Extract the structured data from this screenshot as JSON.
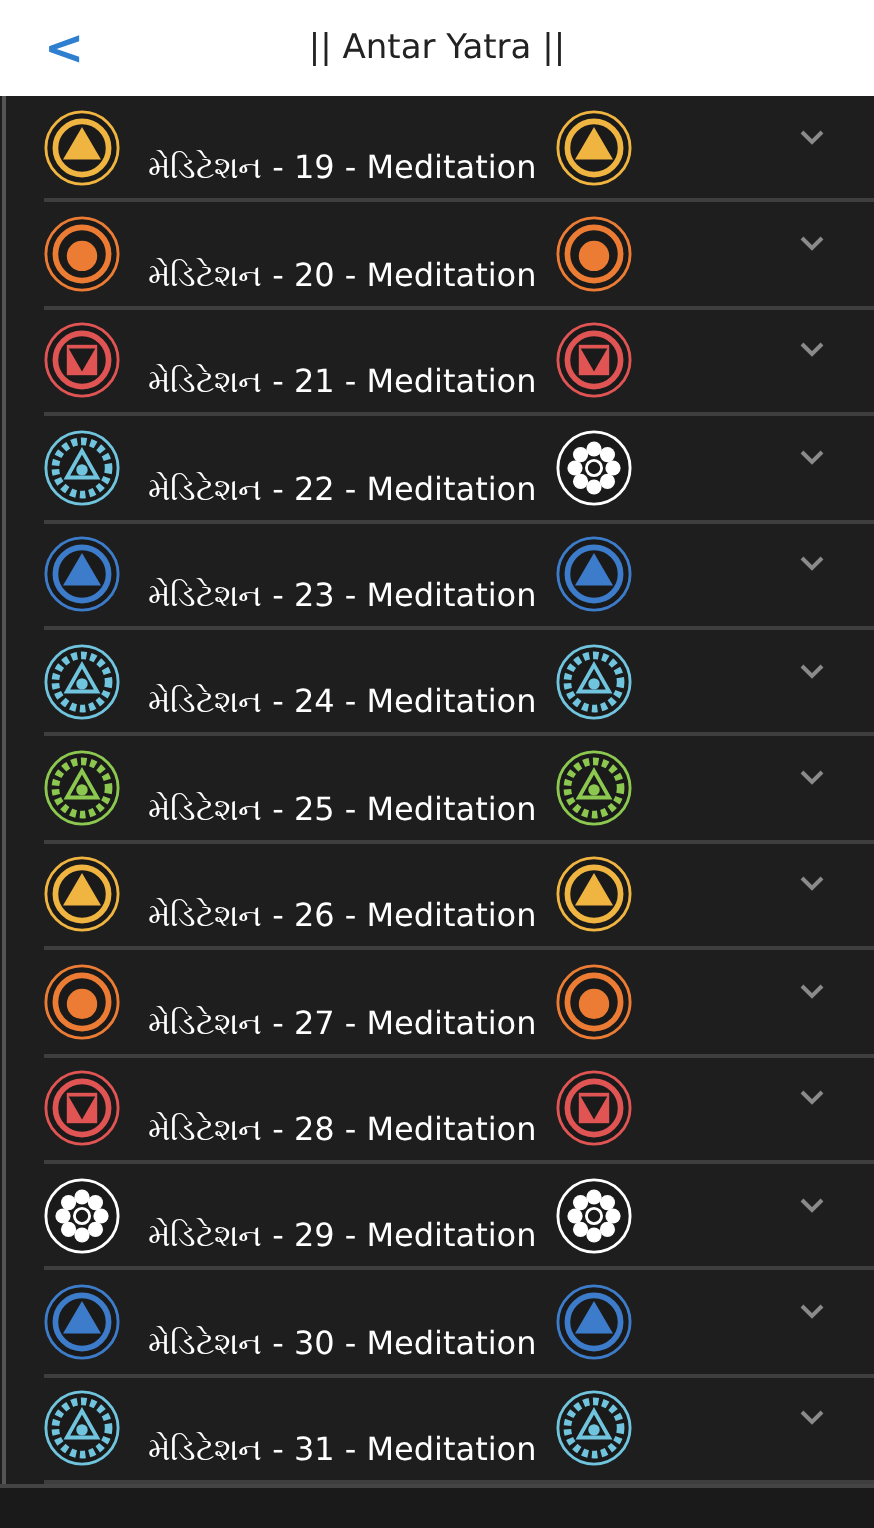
{
  "header": {
    "back": "<",
    "title": "|| Antar Yatra ||"
  },
  "rows": [
    {
      "label": "મેડિટેશન - 19 - Meditation",
      "expanded": false,
      "icons": [
        {
          "kind": "triangle",
          "color": "#f0b440"
        },
        {
          "kind": "triangle",
          "color": "#f0b440"
        }
      ]
    },
    {
      "label": "મેડિટેશન - 20 - Meditation",
      "expanded": false,
      "icons": [
        {
          "kind": "circle",
          "color": "#ec7c34"
        },
        {
          "kind": "circle",
          "color": "#ec7c34"
        }
      ]
    },
    {
      "label": "મેડિટેશન - 21 - Meditation",
      "expanded": false,
      "icons": [
        {
          "kind": "down-triangle",
          "color": "#e05454"
        },
        {
          "kind": "down-triangle",
          "color": "#e05454"
        }
      ]
    },
    {
      "label": "મેડિટેશન - 22 - Meditation",
      "expanded": false,
      "icons": [
        {
          "kind": "gear",
          "color": "#70c4de"
        },
        {
          "kind": "lotus",
          "color": "#ffffff"
        }
      ]
    },
    {
      "label": "મેડિટેશન - 23 - Meditation",
      "expanded": false,
      "icons": [
        {
          "kind": "triangle",
          "color": "#3c7cca"
        },
        {
          "kind": "triangle",
          "color": "#3c7cca"
        }
      ]
    },
    {
      "label": "મેડિટેશન - 24 - Meditation",
      "expanded": false,
      "icons": [
        {
          "kind": "gear",
          "color": "#70c4de"
        },
        {
          "kind": "gear",
          "color": "#70c4de"
        }
      ]
    },
    {
      "label": "મેડિટેશન - 25 - Meditation",
      "expanded": false,
      "icons": [
        {
          "kind": "gear",
          "color": "#8cc850"
        },
        {
          "kind": "gear",
          "color": "#8cc850"
        }
      ]
    },
    {
      "label": "મેડિટેશન - 26 - Meditation",
      "expanded": false,
      "icons": [
        {
          "kind": "triangle",
          "color": "#f0b440"
        },
        {
          "kind": "triangle",
          "color": "#f0b440"
        }
      ]
    },
    {
      "label": "મેડિટેશન - 27 - Meditation",
      "expanded": false,
      "icons": [
        {
          "kind": "circle",
          "color": "#ec7c34"
        },
        {
          "kind": "circle",
          "color": "#ec7c34"
        }
      ]
    },
    {
      "label": "મેડિટેશન - 28 - Meditation",
      "expanded": false,
      "icons": [
        {
          "kind": "down-triangle",
          "color": "#e05454"
        },
        {
          "kind": "down-triangle",
          "color": "#e05454"
        }
      ]
    },
    {
      "label": "મેડિટેશન - 29 - Meditation",
      "expanded": false,
      "icons": [
        {
          "kind": "lotus",
          "color": "#ffffff"
        },
        {
          "kind": "lotus",
          "color": "#ffffff"
        }
      ]
    },
    {
      "label": "મેડિટેશન - 30 - Meditation",
      "expanded": false,
      "icons": [
        {
          "kind": "triangle",
          "color": "#3c7cca"
        },
        {
          "kind": "triangle",
          "color": "#3c7cca"
        }
      ]
    },
    {
      "label": "મેડિટેશન - 31 - Meditation",
      "expanded": false,
      "icons": [
        {
          "kind": "gear",
          "color": "#70c4de"
        },
        {
          "kind": "gear",
          "color": "#70c4de"
        }
      ]
    }
  ]
}
